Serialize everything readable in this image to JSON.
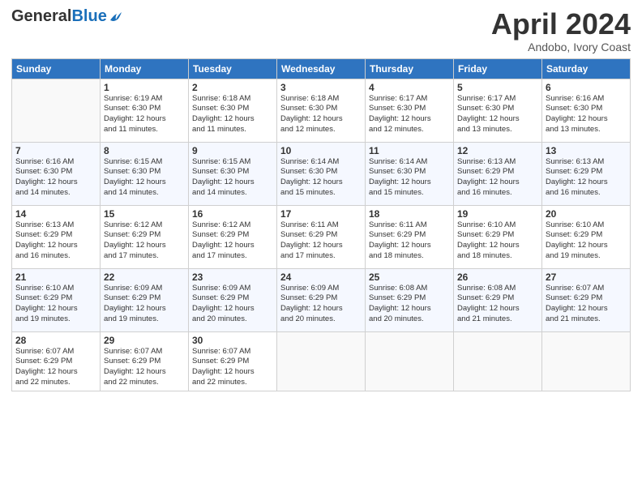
{
  "header": {
    "logo": {
      "general": "General",
      "blue": "Blue"
    },
    "title": "April 2024",
    "subtitle": "Andobo, Ivory Coast"
  },
  "weekdays": [
    "Sunday",
    "Monday",
    "Tuesday",
    "Wednesday",
    "Thursday",
    "Friday",
    "Saturday"
  ],
  "weeks": [
    [
      {
        "day": "",
        "info": ""
      },
      {
        "day": "1",
        "info": "Sunrise: 6:19 AM\nSunset: 6:30 PM\nDaylight: 12 hours\nand 11 minutes."
      },
      {
        "day": "2",
        "info": "Sunrise: 6:18 AM\nSunset: 6:30 PM\nDaylight: 12 hours\nand 11 minutes."
      },
      {
        "day": "3",
        "info": "Sunrise: 6:18 AM\nSunset: 6:30 PM\nDaylight: 12 hours\nand 12 minutes."
      },
      {
        "day": "4",
        "info": "Sunrise: 6:17 AM\nSunset: 6:30 PM\nDaylight: 12 hours\nand 12 minutes."
      },
      {
        "day": "5",
        "info": "Sunrise: 6:17 AM\nSunset: 6:30 PM\nDaylight: 12 hours\nand 13 minutes."
      },
      {
        "day": "6",
        "info": "Sunrise: 6:16 AM\nSunset: 6:30 PM\nDaylight: 12 hours\nand 13 minutes."
      }
    ],
    [
      {
        "day": "7",
        "info": "Sunrise: 6:16 AM\nSunset: 6:30 PM\nDaylight: 12 hours\nand 14 minutes."
      },
      {
        "day": "8",
        "info": "Sunrise: 6:15 AM\nSunset: 6:30 PM\nDaylight: 12 hours\nand 14 minutes."
      },
      {
        "day": "9",
        "info": "Sunrise: 6:15 AM\nSunset: 6:30 PM\nDaylight: 12 hours\nand 14 minutes."
      },
      {
        "day": "10",
        "info": "Sunrise: 6:14 AM\nSunset: 6:30 PM\nDaylight: 12 hours\nand 15 minutes."
      },
      {
        "day": "11",
        "info": "Sunrise: 6:14 AM\nSunset: 6:30 PM\nDaylight: 12 hours\nand 15 minutes."
      },
      {
        "day": "12",
        "info": "Sunrise: 6:13 AM\nSunset: 6:29 PM\nDaylight: 12 hours\nand 16 minutes."
      },
      {
        "day": "13",
        "info": "Sunrise: 6:13 AM\nSunset: 6:29 PM\nDaylight: 12 hours\nand 16 minutes."
      }
    ],
    [
      {
        "day": "14",
        "info": "Sunrise: 6:13 AM\nSunset: 6:29 PM\nDaylight: 12 hours\nand 16 minutes."
      },
      {
        "day": "15",
        "info": "Sunrise: 6:12 AM\nSunset: 6:29 PM\nDaylight: 12 hours\nand 17 minutes."
      },
      {
        "day": "16",
        "info": "Sunrise: 6:12 AM\nSunset: 6:29 PM\nDaylight: 12 hours\nand 17 minutes."
      },
      {
        "day": "17",
        "info": "Sunrise: 6:11 AM\nSunset: 6:29 PM\nDaylight: 12 hours\nand 17 minutes."
      },
      {
        "day": "18",
        "info": "Sunrise: 6:11 AM\nSunset: 6:29 PM\nDaylight: 12 hours\nand 18 minutes."
      },
      {
        "day": "19",
        "info": "Sunrise: 6:10 AM\nSunset: 6:29 PM\nDaylight: 12 hours\nand 18 minutes."
      },
      {
        "day": "20",
        "info": "Sunrise: 6:10 AM\nSunset: 6:29 PM\nDaylight: 12 hours\nand 19 minutes."
      }
    ],
    [
      {
        "day": "21",
        "info": "Sunrise: 6:10 AM\nSunset: 6:29 PM\nDaylight: 12 hours\nand 19 minutes."
      },
      {
        "day": "22",
        "info": "Sunrise: 6:09 AM\nSunset: 6:29 PM\nDaylight: 12 hours\nand 19 minutes."
      },
      {
        "day": "23",
        "info": "Sunrise: 6:09 AM\nSunset: 6:29 PM\nDaylight: 12 hours\nand 20 minutes."
      },
      {
        "day": "24",
        "info": "Sunrise: 6:09 AM\nSunset: 6:29 PM\nDaylight: 12 hours\nand 20 minutes."
      },
      {
        "day": "25",
        "info": "Sunrise: 6:08 AM\nSunset: 6:29 PM\nDaylight: 12 hours\nand 20 minutes."
      },
      {
        "day": "26",
        "info": "Sunrise: 6:08 AM\nSunset: 6:29 PM\nDaylight: 12 hours\nand 21 minutes."
      },
      {
        "day": "27",
        "info": "Sunrise: 6:07 AM\nSunset: 6:29 PM\nDaylight: 12 hours\nand 21 minutes."
      }
    ],
    [
      {
        "day": "28",
        "info": "Sunrise: 6:07 AM\nSunset: 6:29 PM\nDaylight: 12 hours\nand 22 minutes."
      },
      {
        "day": "29",
        "info": "Sunrise: 6:07 AM\nSunset: 6:29 PM\nDaylight: 12 hours\nand 22 minutes."
      },
      {
        "day": "30",
        "info": "Sunrise: 6:07 AM\nSunset: 6:29 PM\nDaylight: 12 hours\nand 22 minutes."
      },
      {
        "day": "",
        "info": ""
      },
      {
        "day": "",
        "info": ""
      },
      {
        "day": "",
        "info": ""
      },
      {
        "day": "",
        "info": ""
      }
    ]
  ]
}
